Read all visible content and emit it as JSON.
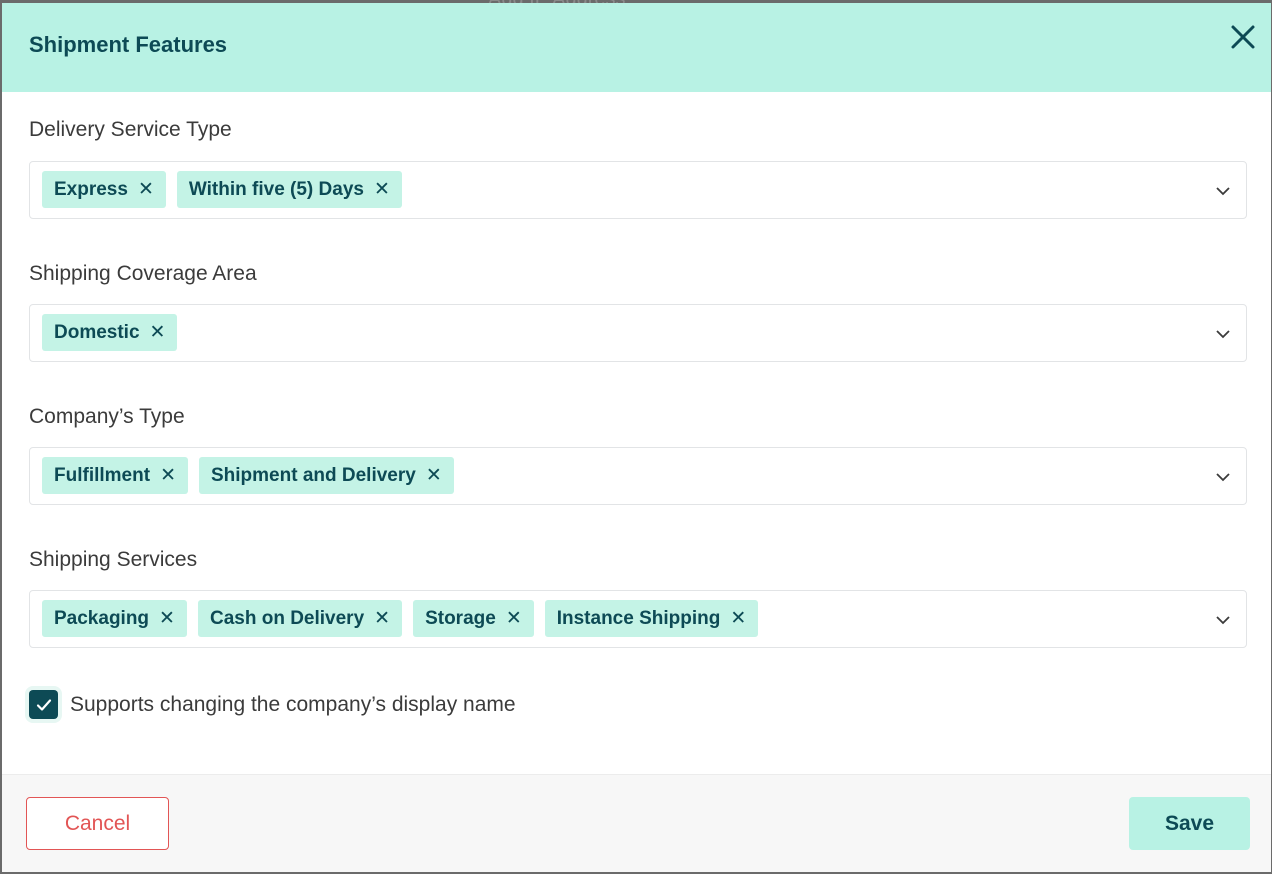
{
  "backdrop": {
    "text": "Add IP Address"
  },
  "modal": {
    "title": "Shipment Features",
    "close_icon": "close-icon"
  },
  "fields": [
    {
      "label": "Delivery Service Type",
      "chips": [
        "Express",
        "Within five (5) Days"
      ]
    },
    {
      "label": "Shipping Coverage Area",
      "chips": [
        "Domestic"
      ]
    },
    {
      "label": "Company’s Type",
      "chips": [
        "Fulfillment",
        "Shipment and Delivery"
      ]
    },
    {
      "label": "Shipping Services",
      "chips": [
        "Packaging",
        "Cash on Delivery",
        "Storage",
        "Instance Shipping"
      ]
    }
  ],
  "checkbox": {
    "checked": true,
    "label": "Supports changing the company’s display name"
  },
  "footer": {
    "cancel_label": "Cancel",
    "save_label": "Save"
  },
  "colors": {
    "accent": "#b8f2e4",
    "chip_bg": "#c4f3e6",
    "primary_text": "#0d4a55",
    "danger": "#e25555"
  }
}
